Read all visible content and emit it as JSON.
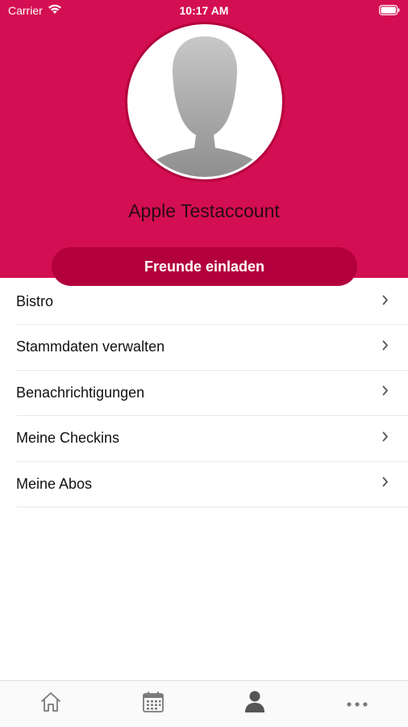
{
  "status_bar": {
    "carrier": "Carrier",
    "time": "10:17 AM"
  },
  "profile": {
    "name": "Apple Testaccount",
    "invite_label": "Freunde einladen"
  },
  "menu": {
    "items": [
      {
        "label": "Bistro"
      },
      {
        "label": "Stammdaten verwalten"
      },
      {
        "label": "Benachrichtigungen"
      },
      {
        "label": "Meine Checkins"
      },
      {
        "label": "Meine Abos"
      }
    ]
  },
  "tab_bar": {
    "tabs": [
      {
        "icon": "home-icon"
      },
      {
        "icon": "calendar-icon"
      },
      {
        "icon": "profile-icon",
        "active": true
      },
      {
        "icon": "more-icon"
      }
    ]
  },
  "colors": {
    "brand": "#d40e52",
    "button": "#b3003c",
    "icon_inactive": "#7a7a7a",
    "icon_active": "#555555"
  }
}
